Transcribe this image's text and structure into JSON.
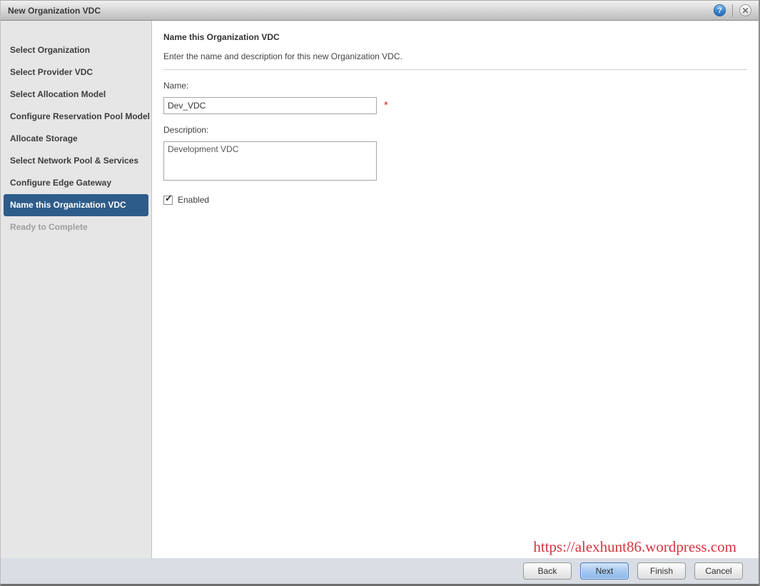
{
  "window": {
    "title": "New Organization VDC",
    "help_glyph": "?",
    "close_glyph": "✕"
  },
  "sidebar": {
    "items": [
      {
        "label": "Select Organization",
        "state": "normal"
      },
      {
        "label": "Select Provider VDC",
        "state": "normal"
      },
      {
        "label": "Select Allocation Model",
        "state": "normal"
      },
      {
        "label": "Configure Reservation Pool Model",
        "state": "normal"
      },
      {
        "label": "Allocate Storage",
        "state": "normal"
      },
      {
        "label": "Select Network Pool & Services",
        "state": "normal"
      },
      {
        "label": "Configure Edge Gateway",
        "state": "normal"
      },
      {
        "label": "Name this Organization VDC",
        "state": "active"
      },
      {
        "label": "Ready to Complete",
        "state": "disabled"
      }
    ]
  },
  "content": {
    "heading": "Name this Organization VDC",
    "subtitle": "Enter the name and description for this new Organization VDC.",
    "name_label": "Name:",
    "name_value": "Dev_VDC",
    "required_marker": "*",
    "description_label": "Description:",
    "description_value": "Development VDC",
    "enabled_label": "Enabled",
    "enabled_checked": true,
    "check_glyph": "✓"
  },
  "watermark": {
    "text": "https://alexhunt86.wordpress.com"
  },
  "footer": {
    "buttons": [
      {
        "label": "Back",
        "primary": false
      },
      {
        "label": "Next",
        "primary": true
      },
      {
        "label": "Finish",
        "primary": false
      },
      {
        "label": "Cancel",
        "primary": false
      }
    ]
  },
  "colors": {
    "active_step_bg": "#2e5c8a",
    "primary_button_border": "#4b7cba",
    "required_red": "#c9302c",
    "watermark_red": "#d7343f",
    "sidebar_bg": "#e6e6e6",
    "footer_bg": "#d9dde4"
  }
}
